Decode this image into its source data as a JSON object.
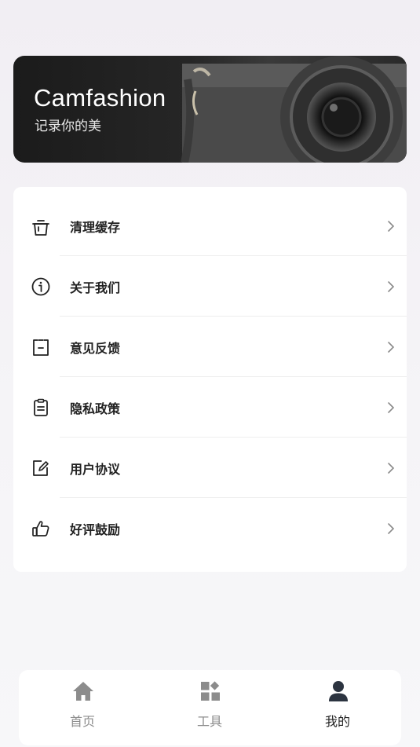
{
  "banner": {
    "title": "Camfashion",
    "subtitle": "记录你的美"
  },
  "menu": {
    "items": [
      {
        "label": "清理缓存",
        "icon": "trash-icon"
      },
      {
        "label": "关于我们",
        "icon": "info-icon"
      },
      {
        "label": "意见反馈",
        "icon": "feedback-icon"
      },
      {
        "label": "隐私政策",
        "icon": "clipboard-icon"
      },
      {
        "label": "用户协议",
        "icon": "edit-icon"
      },
      {
        "label": "好评鼓励",
        "icon": "thumbs-up-icon"
      }
    ]
  },
  "tabbar": {
    "tabs": [
      {
        "label": "首页",
        "icon": "home-icon",
        "active": false
      },
      {
        "label": "工具",
        "icon": "tools-icon",
        "active": false
      },
      {
        "label": "我的",
        "icon": "user-icon",
        "active": true
      }
    ]
  },
  "colors": {
    "active_tab": "#2c3440",
    "inactive_tab": "#8c8c8c",
    "menu_text": "#222222"
  }
}
